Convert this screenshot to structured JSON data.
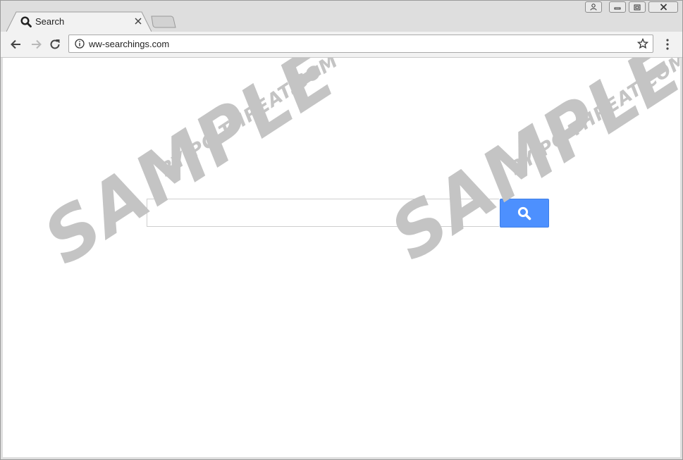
{
  "browser": {
    "tab": {
      "title": "Search",
      "favicon": "search-icon"
    },
    "address_bar": {
      "url": "ww-searchings.com"
    }
  },
  "page": {
    "search": {
      "placeholder": "",
      "value": "",
      "button_icon": "search-icon",
      "button_color": "#4d90fe"
    }
  },
  "watermark": {
    "main_text": "SAMPLE",
    "sub_text": "BY PC THREAT.COM"
  }
}
